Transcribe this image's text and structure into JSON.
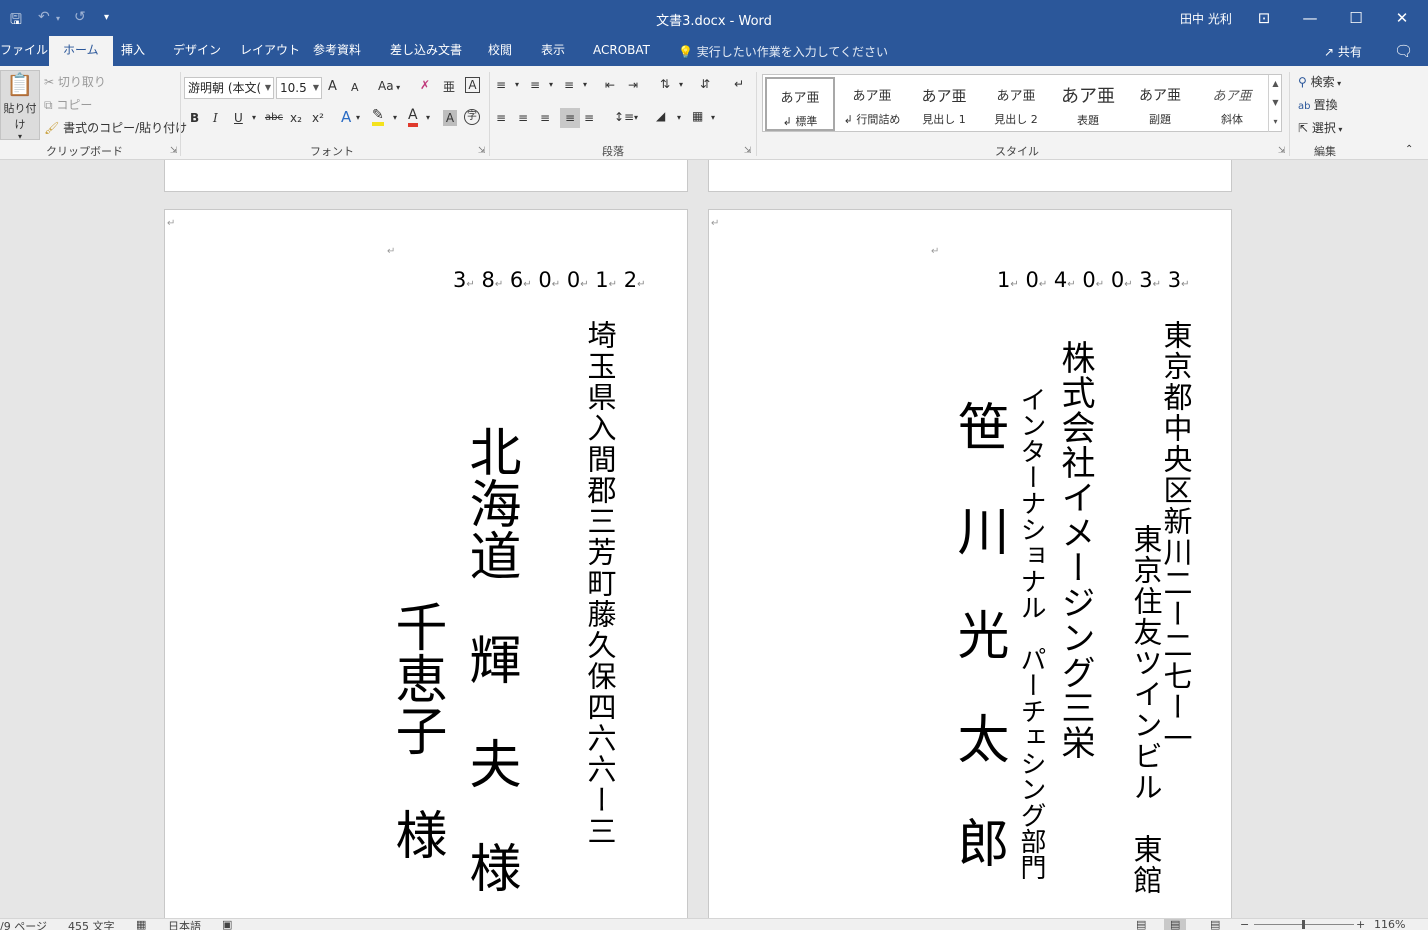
{
  "window": {
    "title": "文書3.docx  -  Word",
    "user": "田中 光利",
    "controls": [
      "⊡",
      "—",
      "☐",
      "✕"
    ]
  },
  "quick_access": [
    "save-icon",
    "undo-icon",
    "redo-icon",
    "customize-icon"
  ],
  "tabs": [
    "ファイル",
    "ホーム",
    "挿入",
    "デザイン",
    "レイアウト",
    "参考資料",
    "差し込み文書",
    "校閲",
    "表示",
    "ACROBAT"
  ],
  "active_tab": "ホーム",
  "tell_me": "実行したい作業を入力してください",
  "share": "共有",
  "clipboard": {
    "paste": "貼り付け",
    "cut": "切り取り",
    "copy": "コピー",
    "format_painter": "書式のコピー/貼り付け",
    "label": "クリップボード"
  },
  "font": {
    "name": "游明朝 (本文(",
    "size": "10.5",
    "grow": "A",
    "shrink": "A",
    "case": "Aa",
    "bold": "B",
    "italic": "I",
    "underline": "U",
    "strike": "abc",
    "subscript": "x₂",
    "superscript": "x²",
    "label": "フォント"
  },
  "paragraph": {
    "label": "段落"
  },
  "styles": {
    "label": "スタイル",
    "items": [
      {
        "sample": "あア亜",
        "name": "↲ 標準"
      },
      {
        "sample": "あア亜",
        "name": "↲ 行間詰め"
      },
      {
        "sample": "あア亜",
        "name": "見出し 1"
      },
      {
        "sample": "あア亜",
        "name": "見出し 2"
      },
      {
        "sample": "あア亜",
        "name": "表題"
      },
      {
        "sample": "あア亜",
        "name": "副題"
      },
      {
        "sample": "あア亜",
        "name": "斜体"
      }
    ]
  },
  "editing": {
    "find": "検索",
    "replace": "置換",
    "select": "選択",
    "label": "編集"
  },
  "left_card": {
    "postal_digits": [
      "3",
      "8",
      "6",
      "0",
      "0",
      "1",
      "2"
    ],
    "address": "埼玉県入間郡三芳町藤久保四六六ー三",
    "recipient_1": "北海道　輝　夫　様",
    "recipient_2": "千恵子　様"
  },
  "right_card": {
    "postal_digits": [
      "1",
      "0",
      "4",
      "0",
      "0",
      "3",
      "3"
    ],
    "address_1": "東京都中央区新川二ー二七ー一",
    "address_2": "東京住友ツインビル　東館",
    "company": "株式会社イメージング三栄",
    "department": "インターナショナル　パーチェシング部門",
    "recipient": "笹　川　光　太　郎　様"
  },
  "statusbar": {
    "page": "/9 ページ",
    "words": "455 文字",
    "language": "日本語",
    "zoom": "116%"
  }
}
